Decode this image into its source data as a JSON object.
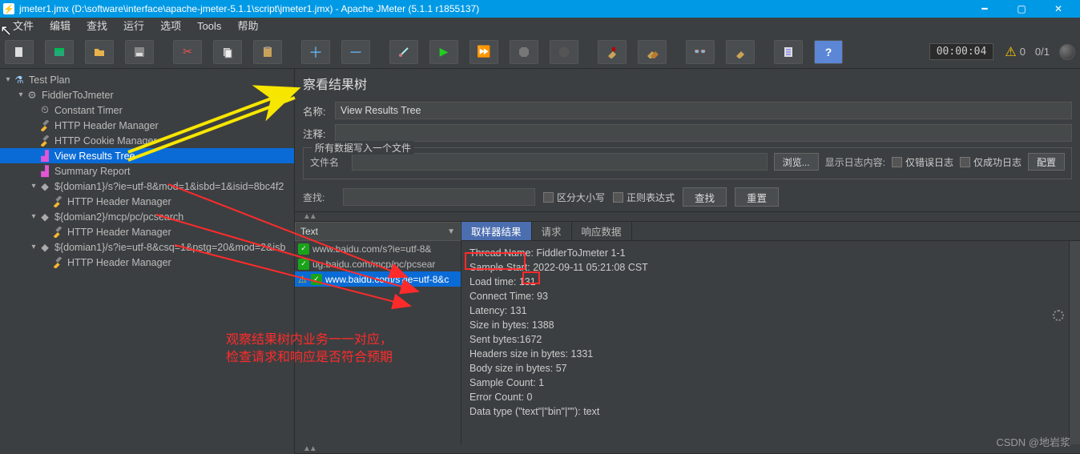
{
  "window": {
    "title": "jmeter1.jmx (D:\\software\\interface\\apache-jmeter-5.1.1\\script\\jmeter1.jmx) - Apache JMeter (5.1.1 r1855137)"
  },
  "menu": {
    "file": "文件",
    "edit": "编辑",
    "search": "查找",
    "run": "运行",
    "options": "选项",
    "tools": "Tools",
    "help": "帮助"
  },
  "toolbar_icons": {
    "new": "new-file-icon",
    "templates": "templates-icon",
    "open": "open-icon",
    "save": "save-icon",
    "cut": "cut-icon",
    "copy": "copy-icon",
    "paste": "paste-icon",
    "plus": "plus-icon",
    "minus": "minus-icon",
    "toggle": "toggle-icon",
    "run_green": "run-icon",
    "run_no_pauses": "run-no-pauses-icon",
    "stop": "stop-icon",
    "shutdown": "shutdown-icon",
    "clear1": "clear-icon",
    "clear_all": "clear-all-icon",
    "find": "find-icon",
    "fn_helper": "function-helper-icon",
    "doc": "doc-icon",
    "help": "help-icon"
  },
  "status": {
    "time": "00:00:04",
    "warn_count": "0",
    "threads": "0/1"
  },
  "tree": {
    "items": [
      {
        "depth": 0,
        "exp": "▾",
        "icon": "flask",
        "label": "Test Plan"
      },
      {
        "depth": 1,
        "exp": "▾",
        "icon": "gear",
        "label": "FiddlerToJmeter"
      },
      {
        "depth": 2,
        "exp": "",
        "icon": "clock",
        "label": "Constant Timer"
      },
      {
        "depth": 2,
        "exp": "",
        "icon": "wrench",
        "label": "HTTP Header Manager"
      },
      {
        "depth": 2,
        "exp": "",
        "icon": "wrench",
        "label": "HTTP Cookie Manager"
      },
      {
        "depth": 2,
        "exp": "",
        "icon": "chart",
        "label": "View Results Tree",
        "sel": true
      },
      {
        "depth": 2,
        "exp": "",
        "icon": "chart",
        "label": "Summary Report"
      },
      {
        "depth": 2,
        "exp": "▾",
        "icon": "default",
        "label": "${domian1}/s?ie=utf-8&mod=1&isbd=1&isid=8bc4f2"
      },
      {
        "depth": 3,
        "exp": "",
        "icon": "wrench",
        "label": "HTTP Header Manager"
      },
      {
        "depth": 2,
        "exp": "▾",
        "icon": "default",
        "label": "${domian2}/mcp/pc/pcsearch"
      },
      {
        "depth": 3,
        "exp": "",
        "icon": "wrench",
        "label": "HTTP Header Manager"
      },
      {
        "depth": 2,
        "exp": "▾",
        "icon": "default",
        "label": "${domian1}/s?ie=utf-8&csq=1&pstg=20&mod=2&isb"
      },
      {
        "depth": 3,
        "exp": "",
        "icon": "wrench",
        "label": "HTTP Header Manager"
      }
    ]
  },
  "panel": {
    "heading": "察看结果树",
    "name_lbl": "名称:",
    "name_val": "View Results Tree",
    "comment_lbl": "注释:",
    "comment_val": "",
    "file_legend": "所有数据写入一个文件",
    "filename_lbl": "文件名",
    "filename_val": "",
    "browse_btn": "浏览...",
    "logshow_lbl": "显示日志内容:",
    "errors_only": "仅错误日志",
    "success_only": "仅成功日志",
    "configure_btn": "配置",
    "search_lbl": "查找:",
    "case_cb": "区分大小写",
    "regex_cb": "正则表达式",
    "search_btn": "查找",
    "reset_btn": "重置",
    "renderer": "Text"
  },
  "results": {
    "items": [
      {
        "ok": true,
        "warn": false,
        "label": "www.baidu.com/s?ie=utf-8&"
      },
      {
        "ok": true,
        "warn": false,
        "label": "ug.baidu.com/mcp/pc/pcsear"
      },
      {
        "ok": true,
        "warn": true,
        "label": "www.baidu.com/s?ie=utf-8&c",
        "sel": true
      }
    ],
    "tabs": {
      "sampler": "取样器结果",
      "request": "请求",
      "response": "响应数据"
    },
    "details": [
      "Thread Name: FiddlerToJmeter 1-1",
      "Sample Start: 2022-09-11 05:21:08 CST",
      "Load time: 131",
      "Connect Time: 93",
      "Latency: 131",
      "Size in bytes: 1388",
      "Sent bytes:1672",
      "Headers size in bytes: 1331",
      "Body size in bytes: 57",
      "Sample Count: 1",
      "Error Count: 0",
      "Data type (\"text\"|\"bin\"|\"\"): text"
    ]
  },
  "annotations": {
    "line1": "观察结果树内业务一一对应，",
    "line2": "检查请求和响应是否符合预期"
  },
  "watermark": "CSDN @地岩浆"
}
